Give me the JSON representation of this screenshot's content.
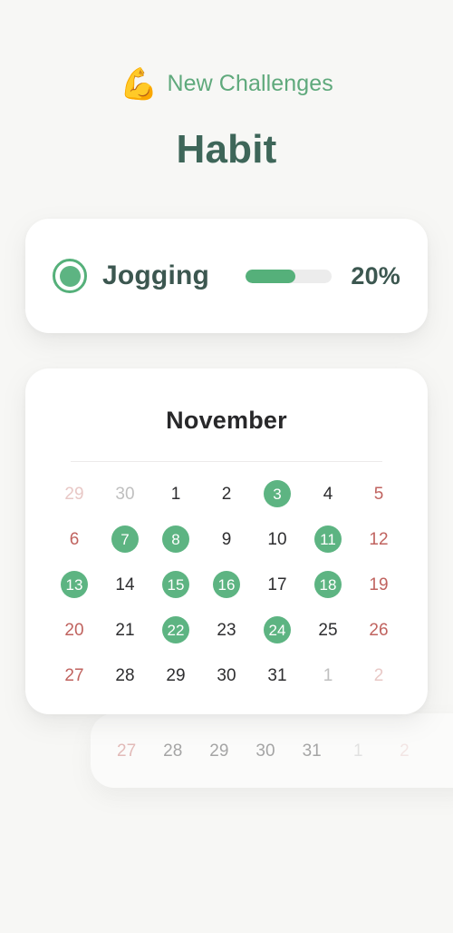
{
  "header": {
    "eyebrow_emoji": "💪",
    "eyebrow_emoji_name": "flexed-biceps-emoji",
    "eyebrow_text": "New Challenges",
    "title": "Habit"
  },
  "habit": {
    "radio_icon": "radio-selected-icon",
    "name": "Jogging",
    "progress_label": "20%",
    "progress_percent": 57
  },
  "calendar": {
    "month_title": "November",
    "weeks": [
      [
        {
          "label": "29",
          "style": "muted-wknd",
          "marked": false
        },
        {
          "label": "30",
          "style": "muted",
          "marked": false
        },
        {
          "label": "1",
          "style": "normal",
          "marked": false
        },
        {
          "label": "2",
          "style": "normal",
          "marked": false
        },
        {
          "label": "3",
          "style": "normal",
          "marked": true
        },
        {
          "label": "4",
          "style": "normal",
          "marked": false
        },
        {
          "label": "5",
          "style": "wknd",
          "marked": false
        }
      ],
      [
        {
          "label": "6",
          "style": "wknd",
          "marked": false
        },
        {
          "label": "7",
          "style": "normal",
          "marked": true
        },
        {
          "label": "8",
          "style": "normal",
          "marked": true
        },
        {
          "label": "9",
          "style": "normal",
          "marked": false
        },
        {
          "label": "10",
          "style": "normal",
          "marked": false
        },
        {
          "label": "11",
          "style": "normal",
          "marked": true
        },
        {
          "label": "12",
          "style": "wknd",
          "marked": false
        }
      ],
      [
        {
          "label": "13",
          "style": "wknd",
          "marked": true
        },
        {
          "label": "14",
          "style": "normal",
          "marked": false
        },
        {
          "label": "15",
          "style": "normal",
          "marked": true
        },
        {
          "label": "16",
          "style": "normal",
          "marked": true
        },
        {
          "label": "17",
          "style": "normal",
          "marked": false
        },
        {
          "label": "18",
          "style": "normal",
          "marked": true
        },
        {
          "label": "19",
          "style": "wknd",
          "marked": false
        }
      ],
      [
        {
          "label": "20",
          "style": "wknd",
          "marked": false
        },
        {
          "label": "21",
          "style": "normal",
          "marked": false
        },
        {
          "label": "22",
          "style": "normal",
          "marked": true
        },
        {
          "label": "23",
          "style": "normal",
          "marked": false
        },
        {
          "label": "24",
          "style": "normal",
          "marked": true
        },
        {
          "label": "25",
          "style": "normal",
          "marked": false
        },
        {
          "label": "26",
          "style": "wknd",
          "marked": false
        }
      ],
      [
        {
          "label": "27",
          "style": "wknd",
          "marked": false
        },
        {
          "label": "28",
          "style": "normal",
          "marked": false
        },
        {
          "label": "29",
          "style": "normal",
          "marked": false
        },
        {
          "label": "30",
          "style": "normal",
          "marked": false
        },
        {
          "label": "31",
          "style": "normal",
          "marked": false
        },
        {
          "label": "1",
          "style": "muted",
          "marked": false
        },
        {
          "label": "2",
          "style": "muted-wknd",
          "marked": false
        }
      ]
    ],
    "ghost_week": [
      {
        "label": "27",
        "style": "wknd",
        "marked": false
      },
      {
        "label": "28",
        "style": "normal",
        "marked": false
      },
      {
        "label": "29",
        "style": "normal",
        "marked": false
      },
      {
        "label": "30",
        "style": "normal",
        "marked": false
      },
      {
        "label": "31",
        "style": "normal",
        "marked": false
      },
      {
        "label": "1",
        "style": "muted",
        "marked": false
      },
      {
        "label": "2",
        "style": "muted-wknd",
        "marked": false
      }
    ]
  },
  "colors": {
    "background": "#f7f7f5",
    "card": "#ffffff",
    "accent_green": "#5db482",
    "title_green": "#3e6659",
    "eyebrow_green": "#5fa97c",
    "text_dark": "#3c5750",
    "weekend_red": "#c0635f",
    "muted_gray": "#bfbfbf"
  }
}
